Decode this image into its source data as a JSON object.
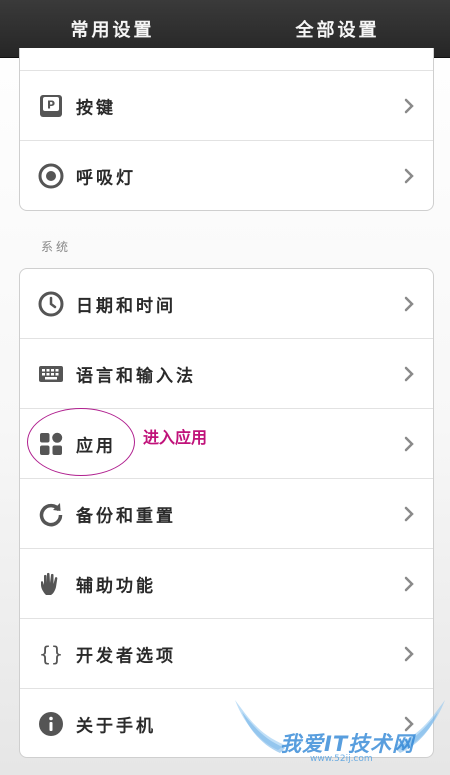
{
  "tabs": [
    {
      "label": "常用设置",
      "active": false
    },
    {
      "label": "全部设置",
      "active": true
    }
  ],
  "group1": {
    "items": [
      {
        "label": "按键",
        "icon": "key-p-icon"
      },
      {
        "label": "呼吸灯",
        "icon": "breathing-light-icon"
      }
    ]
  },
  "section_label": "系统",
  "system": {
    "items": [
      {
        "label": "日期和时间",
        "icon": "clock-icon"
      },
      {
        "label": "语言和输入法",
        "icon": "keyboard-icon"
      },
      {
        "label": "应用",
        "icon": "apps-grid-icon"
      },
      {
        "label": "备份和重置",
        "icon": "refresh-icon"
      },
      {
        "label": "辅助功能",
        "icon": "hand-icon"
      },
      {
        "label": "开发者选项",
        "icon": "braces-icon"
      },
      {
        "label": "关于手机",
        "icon": "info-icon"
      }
    ]
  },
  "annotation": {
    "text": "进入应用",
    "color": "#c0127a"
  },
  "watermark": {
    "text": "我爱IT技术网",
    "url": "www.52ij.com"
  },
  "colors": {
    "tabbar": "#2f2f2f",
    "tab_text": "#f5f5f5",
    "label": "#2a2a2a",
    "icon": "#555555",
    "chevron": "#8a8a8a"
  }
}
